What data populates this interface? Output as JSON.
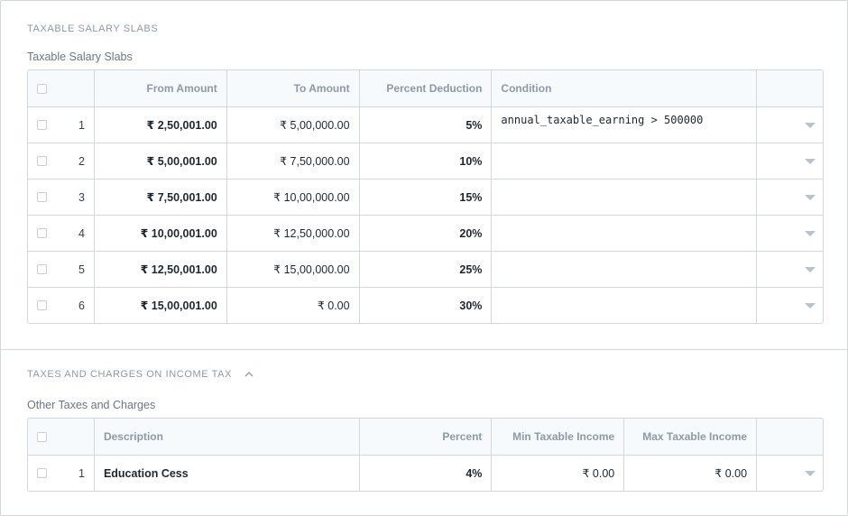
{
  "section1": {
    "heading": "TAXABLE SALARY SLABS",
    "label": "Taxable Salary Slabs",
    "columns": {
      "from": "From Amount",
      "to": "To Amount",
      "percent": "Percent Deduction",
      "condition": "Condition"
    },
    "rows": [
      {
        "idx": "1",
        "from": "₹ 2,50,001.00",
        "to": "₹ 5,00,000.00",
        "percent": "5%",
        "condition": "annual_taxable_earning > 500000"
      },
      {
        "idx": "2",
        "from": "₹ 5,00,001.00",
        "to": "₹ 7,50,000.00",
        "percent": "10%",
        "condition": ""
      },
      {
        "idx": "3",
        "from": "₹ 7,50,001.00",
        "to": "₹ 10,00,000.00",
        "percent": "15%",
        "condition": ""
      },
      {
        "idx": "4",
        "from": "₹ 10,00,001.00",
        "to": "₹ 12,50,000.00",
        "percent": "20%",
        "condition": ""
      },
      {
        "idx": "5",
        "from": "₹ 12,50,001.00",
        "to": "₹ 15,00,000.00",
        "percent": "25%",
        "condition": ""
      },
      {
        "idx": "6",
        "from": "₹ 15,00,001.00",
        "to": "₹ 0.00",
        "percent": "30%",
        "condition": ""
      }
    ]
  },
  "section2": {
    "heading": "TAXES AND CHARGES ON INCOME TAX",
    "label": "Other Taxes and Charges",
    "columns": {
      "description": "Description",
      "percent": "Percent",
      "min": "Min Taxable Income",
      "max": "Max Taxable Income"
    },
    "rows": [
      {
        "idx": "1",
        "description": "Education Cess",
        "percent": "4%",
        "min": "₹ 0.00",
        "max": "₹ 0.00"
      }
    ]
  }
}
